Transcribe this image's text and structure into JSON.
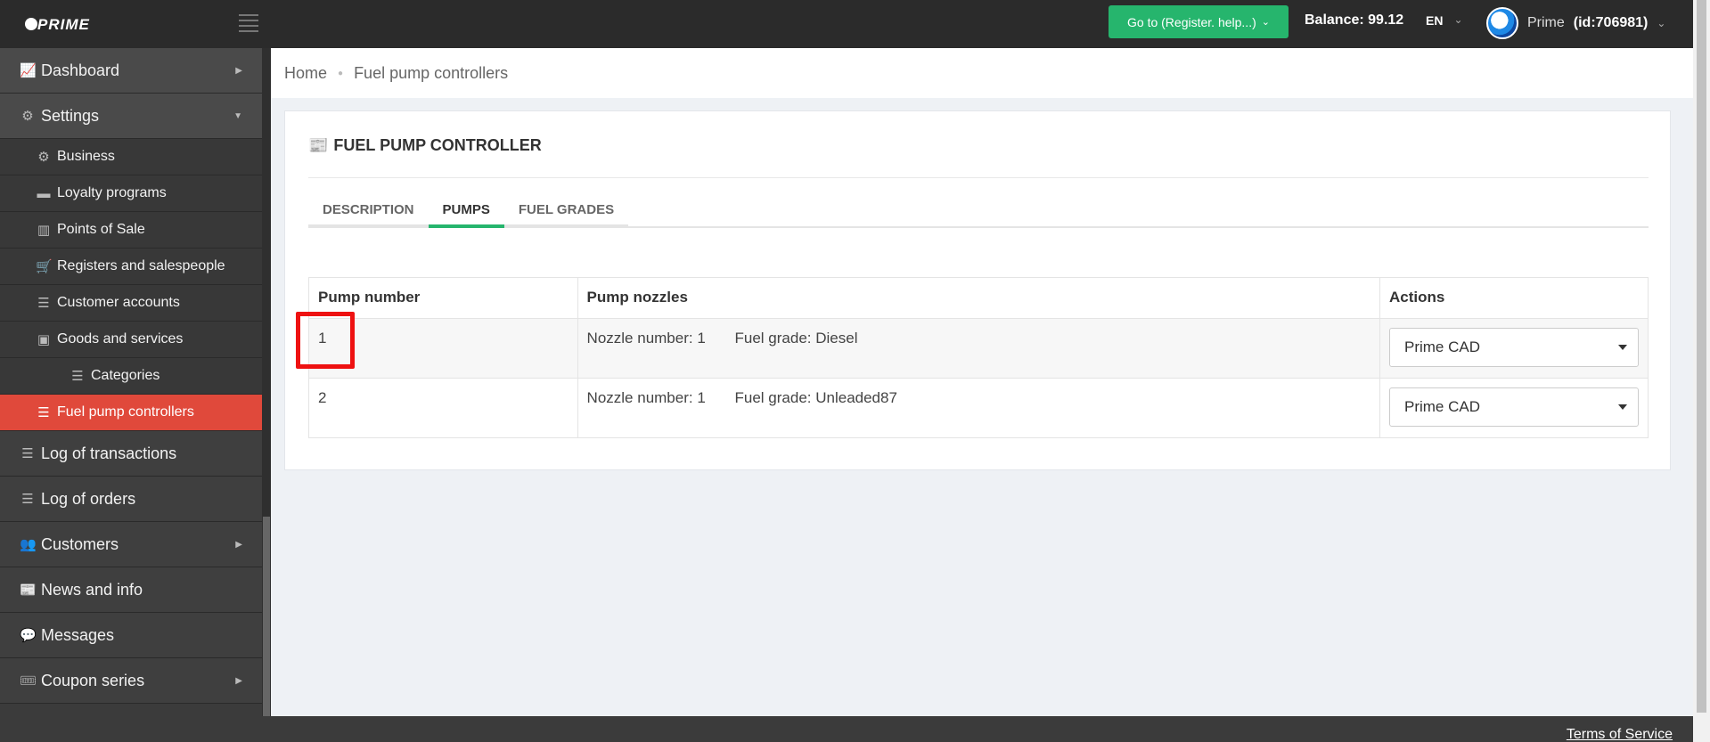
{
  "header": {
    "logo_text": "PRIME",
    "goto_label": "Go to (Register. help...)",
    "balance_label": "Balance:",
    "balance_value": "99.12",
    "language": "EN",
    "user_name": "Prime",
    "user_id": "(id:706981)"
  },
  "sidebar": {
    "items": [
      {
        "label": "Dashboard",
        "icon": "chart-line-icon"
      },
      {
        "label": "Settings",
        "icon": "gear-icon"
      },
      {
        "label": "Business",
        "icon": "gear-icon"
      },
      {
        "label": "Loyalty programs",
        "icon": "briefcase-icon"
      },
      {
        "label": "Points of Sale",
        "icon": "building-icon"
      },
      {
        "label": "Registers and salespeople",
        "icon": "cart-icon"
      },
      {
        "label": "Customer accounts",
        "icon": "list-icon"
      },
      {
        "label": "Goods and services",
        "icon": "archive-icon"
      },
      {
        "label": "Categories",
        "icon": "list-icon"
      },
      {
        "label": "Fuel pump controllers",
        "icon": "list-icon"
      },
      {
        "label": "Log of transactions",
        "icon": "list-icon"
      },
      {
        "label": "Log of orders",
        "icon": "list-icon"
      },
      {
        "label": "Customers",
        "icon": "users-icon"
      },
      {
        "label": "News and info",
        "icon": "newspaper-icon"
      },
      {
        "label": "Messages",
        "icon": "comment-icon"
      },
      {
        "label": "Coupon series",
        "icon": "ticket-icon"
      }
    ]
  },
  "breadcrumb": {
    "home": "Home",
    "current": "Fuel pump controllers"
  },
  "card": {
    "title": "FUEL PUMP CONTROLLER",
    "tabs": [
      "DESCRIPTION",
      "PUMPS",
      "FUEL GRADES"
    ],
    "active_tab": "PUMPS"
  },
  "table": {
    "headers": [
      "Pump number",
      "Pump nozzles",
      "Actions"
    ],
    "rows": [
      {
        "pump": "1",
        "nozzle": "Nozzle number: 1",
        "grade": "Fuel grade: Diesel",
        "action": "Prime CAD"
      },
      {
        "pump": "2",
        "nozzle": "Nozzle number: 1",
        "grade": "Fuel grade: Unleaded87",
        "action": "Prime CAD"
      }
    ]
  },
  "footer": {
    "terms": "Terms of Service"
  },
  "colors": {
    "accent_green": "#26b56d",
    "active_red": "#e0493b",
    "highlight_red": "#ee1111"
  }
}
